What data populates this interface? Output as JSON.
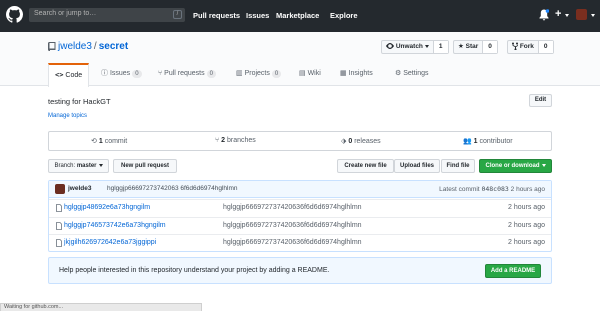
{
  "header": {
    "search_placeholder": "Search or jump to…",
    "search_shortcut": "/",
    "nav": [
      "Pull requests",
      "Issues",
      "Marketplace",
      "Explore"
    ],
    "plus": "+"
  },
  "repo": {
    "owner": "jwelde3",
    "separator": "/",
    "name": "secret",
    "watch_label": "Unwatch",
    "watch_count": "1",
    "star_label": "Star",
    "star_count": "0",
    "fork_label": "Fork",
    "fork_count": "0"
  },
  "tabs": [
    {
      "label": "Code"
    },
    {
      "label": "Issues",
      "count": "0"
    },
    {
      "label": "Pull requests",
      "count": "0"
    },
    {
      "label": "Projects",
      "count": "0"
    },
    {
      "label": "Wiki"
    },
    {
      "label": "Insights"
    },
    {
      "label": "Settings"
    }
  ],
  "about": {
    "description": "testing for HackGT",
    "manage_topics": "Manage topics",
    "edit": "Edit"
  },
  "summary": {
    "commits_num": "1",
    "commits_label": "commit",
    "branches_num": "2",
    "branches_label": "branches",
    "releases_num": "0",
    "releases_label": "releases",
    "contributors_num": "1",
    "contributors_label": "contributor"
  },
  "toolbar": {
    "branch_label": "Branch:",
    "branch_value": "master",
    "new_pr": "New pull request",
    "create_file": "Create new file",
    "upload_files": "Upload files",
    "find_file": "Find file",
    "clone": "Clone or download"
  },
  "commit": {
    "author": "jwelde3",
    "message": "hglggjp66697273742063 6f6d6d6974hglhlmn",
    "latest_label": "Latest commit",
    "sha": "048c083",
    "age": "2 hours ago"
  },
  "files": [
    {
      "name": "hglggjp48692e6a73hgngilm",
      "message": "hglggjp666972737420636f6d6d6974hglhlmn",
      "age": "2 hours ago"
    },
    {
      "name": "hglggjp746573742e6a73hgngilm",
      "message": "hglggjp666972737420636f6d6d6974hglhlmn",
      "age": "2 hours ago"
    },
    {
      "name": "jkjgilh626972642e6a73jggippi",
      "message": "hglggjp666972737420636f6d6d6974hglhlmn",
      "age": "2 hours ago"
    }
  ],
  "readme": {
    "text": "Help people interested in this repository understand your project by adding a README.",
    "button": "Add a README"
  },
  "status": {
    "text": "Waiting for github.com..."
  },
  "icons": [
    "github-logo-icon",
    "bell-icon",
    "plus-icon",
    "avatar-icon",
    "repo-icon",
    "eye-icon",
    "star-icon",
    "fork-icon",
    "code-icon",
    "issue-icon",
    "pull-request-icon",
    "project-icon",
    "book-icon",
    "graph-icon",
    "gear-icon",
    "history-icon",
    "branch-icon",
    "tag-icon",
    "people-icon",
    "file-icon"
  ],
  "colors": {
    "header_bg": "#24292e",
    "link": "#0366d6",
    "green": "#28a745",
    "tab_accent": "#e36209",
    "readme_bg": "#f1f8ff"
  }
}
